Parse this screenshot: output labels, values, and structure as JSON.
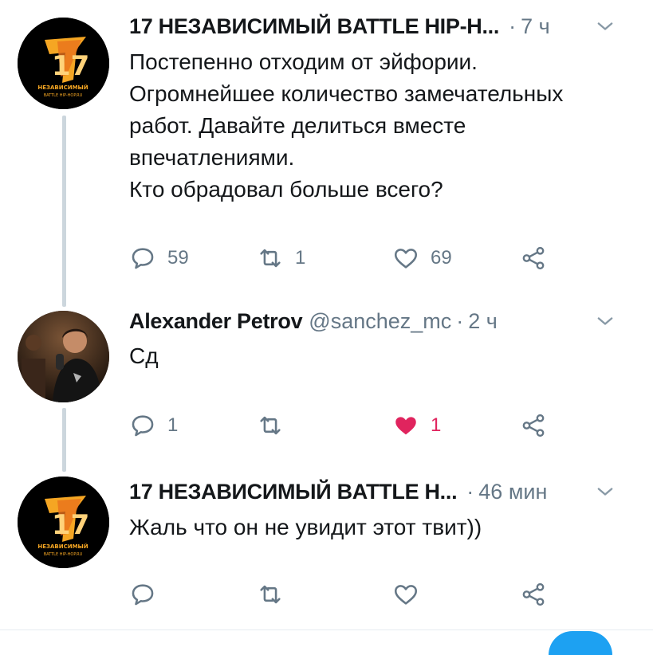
{
  "tweets": [
    {
      "name": "17 НЕЗАВИСИМЫЙ BATTLE HIP-Н...",
      "handle": "",
      "time": "7 ч",
      "text": "Постепенно отходим от эйфории.\nОгромнейшее количество замечательных работ. Давайте делиться вместе впечатлениями.\nКто обрадовал больше всего?",
      "reply_count": "59",
      "retweet_count": "1",
      "like_count": "69",
      "liked": false,
      "avatar": {
        "type": "logo",
        "logo_number": "17",
        "logo_line1": "НЕЗАВИСИМЫЙ",
        "logo_line2": "BATTLE HIP-HOP.RU"
      }
    },
    {
      "name": "Alexander Petrov",
      "handle": "@sanchez_mc",
      "time": "2 ч",
      "text": "Сд",
      "reply_count": "1",
      "retweet_count": "",
      "like_count": "1",
      "liked": true,
      "avatar": {
        "type": "photo"
      }
    },
    {
      "name": "17 НЕЗАВИСИМЫЙ BATTLE Н...",
      "handle": "",
      "time": "46 мин",
      "text": "Жаль что он не увидит этот твит))",
      "reply_count": "",
      "retweet_count": "",
      "like_count": "",
      "liked": false,
      "avatar": {
        "type": "logo",
        "logo_number": "17",
        "logo_line1": "НЕЗАВИСИМЫЙ",
        "logo_line2": "BATTLE HIP-HOP.RU"
      }
    }
  ],
  "dot_separator": "·",
  "colors": {
    "text": "#14171a",
    "secondary": "#657786",
    "like_active": "#e0245e",
    "thread_line": "#ccd6dd",
    "logo_orange": "#f5a623"
  }
}
